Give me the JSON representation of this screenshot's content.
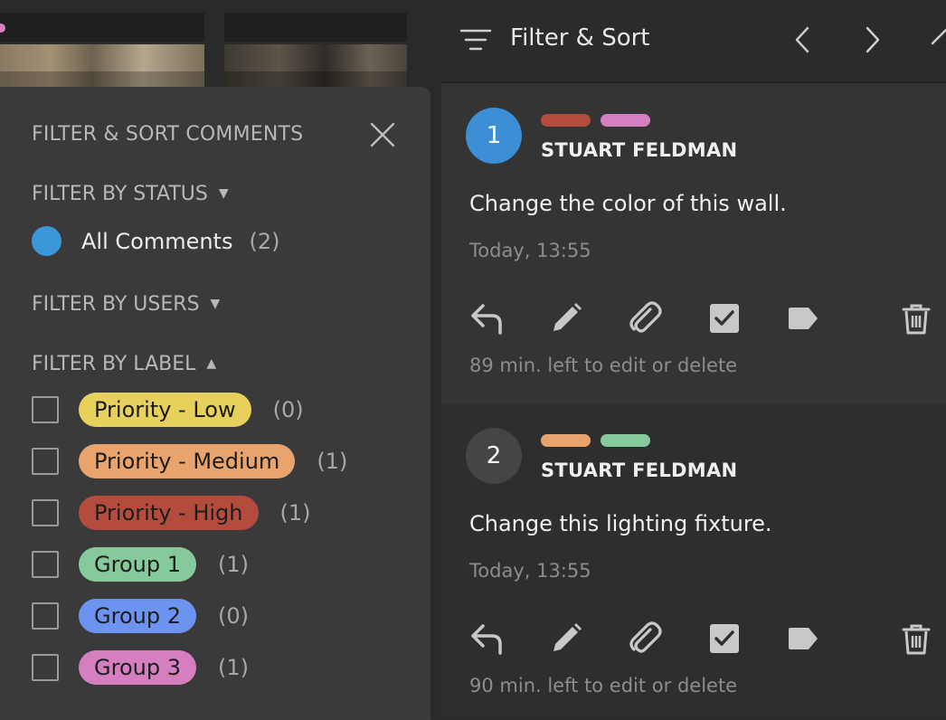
{
  "filter_panel": {
    "title": "FILTER & SORT COMMENTS",
    "status_section": "FILTER BY STATUS",
    "status_caret": "▼",
    "status_option": {
      "label": "All Comments",
      "count": "(2)",
      "color": "#3c97d9"
    },
    "users_section": "FILTER BY USERS",
    "users_caret": "▼",
    "label_section": "FILTER BY LABEL",
    "label_caret": "▲",
    "labels": [
      {
        "label": "Priority - Low",
        "count": "(0)",
        "color": "#e8d05c"
      },
      {
        "label": "Priority - Medium",
        "count": "(1)",
        "color": "#e9a46d"
      },
      {
        "label": "Priority - High",
        "count": "(1)",
        "color": "#b44c3e"
      },
      {
        "label": "Group 1",
        "count": "(1)",
        "color": "#86c99a"
      },
      {
        "label": "Group 2",
        "count": "(0)",
        "color": "#6b93ef"
      },
      {
        "label": "Group 3",
        "count": "(1)",
        "color": "#d57fc1"
      }
    ]
  },
  "right_panel": {
    "title": "Filter & Sort",
    "comments": [
      {
        "number": "1",
        "badge_color": "#3c8fd4",
        "tag_colors": [
          "#b44c3e",
          "#d57fc1"
        ],
        "author": "STUART FELDMAN",
        "text": "Change the color of this wall.",
        "time": "Today, 13:55",
        "note": "89 min. left to edit or delete"
      },
      {
        "number": "2",
        "badge_color": "#454545",
        "tag_colors": [
          "#e9a46d",
          "#86c99a"
        ],
        "author": "STUART FELDMAN",
        "text": "Change this lighting fixture.",
        "time": "Today, 13:55",
        "note": "90 min. left to edit or delete"
      }
    ]
  }
}
